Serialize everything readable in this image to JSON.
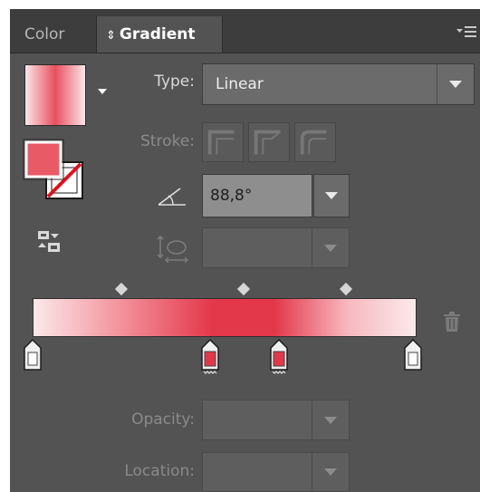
{
  "tabs": [
    {
      "label": "Color",
      "active": false
    },
    {
      "label": "Gradient",
      "active": true
    }
  ],
  "type": {
    "label": "Type:",
    "value": "Linear"
  },
  "stroke": {
    "label": "Stroke:"
  },
  "angle": {
    "value": "88,8°"
  },
  "opacity": {
    "label": "Opacity:"
  },
  "location": {
    "label": "Location:"
  },
  "gradient": {
    "stops": [
      {
        "color": "#f2f2f2",
        "position_pct": 0
      },
      {
        "color": "#e3374a",
        "position_pct": 47
      },
      {
        "color": "#e3374a",
        "position_pct": 64
      },
      {
        "color": "#f2f2f2",
        "position_pct": 100
      }
    ],
    "midpoints_pct": [
      23,
      55,
      82
    ]
  },
  "colors": {
    "panel_bg": "#535353",
    "tabbar_bg": "#3d3d3d",
    "gradient_color": "#e3374a"
  },
  "icons": {
    "tab_arrows": "updown-arrows-icon",
    "panel_menu": "panel-menu-icon",
    "angle": "angle-icon",
    "aspect_ratio": "aspect-ratio-icon",
    "reverse": "reverse-gradient-icon",
    "delete": "trash-icon"
  }
}
